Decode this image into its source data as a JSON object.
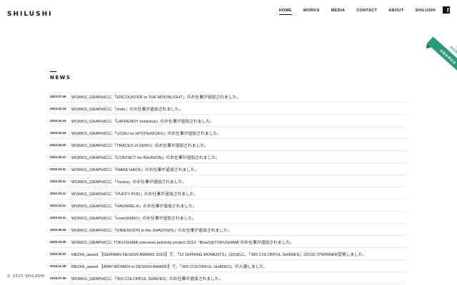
{
  "logo": "SHILUSHI",
  "nav": [
    {
      "label": "HOME",
      "active": true
    },
    {
      "label": "WORKS",
      "active": false
    },
    {
      "label": "MEDIA",
      "active": false
    },
    {
      "label": "CONTACT",
      "active": false
    },
    {
      "label": "ABOUT",
      "active": false
    },
    {
      "label": "SHILUSHI",
      "active": false
    }
  ],
  "facebook": {
    "glyph": "f",
    "icon": "facebook-icon"
  },
  "ribbon": {
    "line1": "HONORS",
    "line2": "AWARDS",
    "color": "#2c9a7e"
  },
  "news": {
    "title": "NEWS",
    "items": [
      {
        "date": "2023.07.06",
        "text": "WORKS_GRAPHICに「ENCOUNTER in THE MOONLIGHT」のお仕事が追加されました。"
      },
      {
        "date": "2023.02.16",
        "text": "WORKS_GRAPHICに「imite」のお仕事が追加されました。"
      },
      {
        "date": "2023.02.16",
        "text": "WORKS_GRAPHICに「LAFRENDY botanical」のお仕事が追加されました。"
      },
      {
        "date": "2023.02.16",
        "text": "WORKS_GRAPHICに「UCHU no HITOSHIZUKU」のお仕事が追加されました。"
      },
      {
        "date": "2022.04.20",
        "text": "WORKS_GRAPHICに「TRACES of ZERO」のお仕事が追加されました。"
      },
      {
        "date": "2022.03.11",
        "text": "WORKS_GRAPHICに「CONTACT for ReUNION」のお仕事が追加されました。"
      },
      {
        "date": "2022.03.11",
        "text": "WORKS_GRAPHICに「MAKE HACK」のお仕事が追加されました。"
      },
      {
        "date": "2022.03.11",
        "text": "WORKS_GRAPHICに「Taviea」のお仕事が追加されました。"
      },
      {
        "date": "2022.03.11",
        "text": "WORKS_GRAPHICに「PUFFY POD」のお仕事が追加されました。"
      },
      {
        "date": "2022.03.11",
        "text": "WORKS_GRAPHICに「HADARELA」のお仕事が追加されました。"
      },
      {
        "date": "2022.03.11",
        "text": "WORKS_GRAPHICに「mowSHIRO」のお仕事が追加されました。"
      },
      {
        "date": "2020.06.26",
        "text": "WORKS_GRAPHICに「DIMENSION in the SHADOWS」のお仕事が追加されました。"
      },
      {
        "date": "2020.03.05",
        "text": "WORKS_GRAPHICに TOKUSHIMA overseas publicity project 2019. \"Blue2@TOKUSHIMA\"のお仕事が追加されました。"
      },
      {
        "date": "2020.02.07",
        "text": "MEDIA_award 【GERMAN DESIGN AWARD 2020】で、「12 SHINING MOMENTS」(2018)と、「365 COLORFUL SHADES」(2019) がWINNER受賞しました。"
      },
      {
        "date": "2019.11.08",
        "text": "MEDIA_award 【AIAP WOMEN in DESIGN AWARD】で、「365 COLORFUL SHADES」が入選しました。"
      },
      {
        "date": "2019.07.09",
        "text": "WORKS_GRAPHICに「365 COLORFUL SHADES」のお仕事が追加されました。"
      }
    ]
  },
  "copyright": "© 2015 SHILUSHI"
}
